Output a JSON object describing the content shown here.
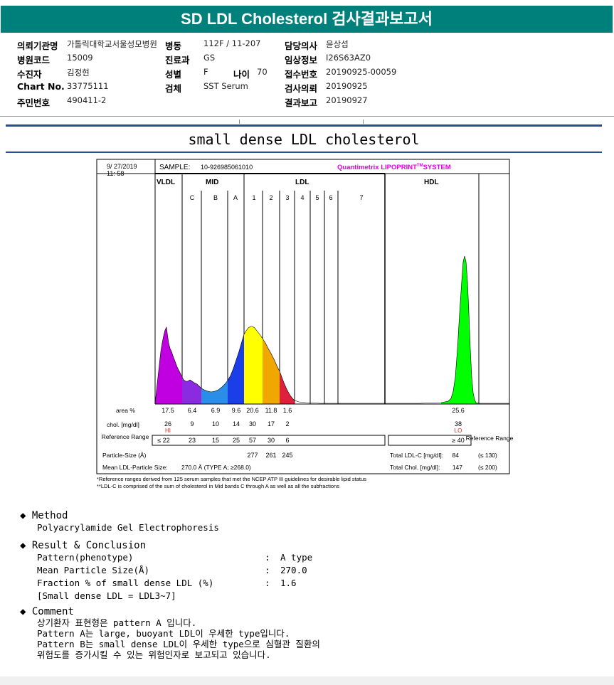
{
  "report_title": "SD LDL Cholesterol 검사결과보고서",
  "info": {
    "r1": {
      "l1": "의뢰기관명",
      "v1": "가톨릭대학교서울성모병원",
      "l2": "병동",
      "v2": "112F / 11-207",
      "l3": "담당의사",
      "v3": "윤상섭"
    },
    "r2": {
      "l1": "병원코드",
      "v1": "15009",
      "l2": "진료과",
      "v2": "GS",
      "l3": "임상정보",
      "v3": "I26S63AZ0"
    },
    "r3": {
      "l1": "수진자",
      "v1": "김정현",
      "l2": "성별",
      "v2": "F",
      "l2b": "나이",
      "v2b": "70",
      "l3": "접수번호",
      "v3": "20190925-00059"
    },
    "r4": {
      "l1": "Chart No.",
      "v1": "33775111",
      "l2": "검체",
      "v2": "SST Serum",
      "l3": "검사의뢰",
      "v3": "20190925"
    },
    "r5": {
      "l1": "주민번호",
      "v1": "490411-2",
      "l3": "결과보고",
      "v3": "20190927"
    }
  },
  "section_title": "small dense LDL cholesterol",
  "chart_data": {
    "type": "area",
    "date": "9/ 27/2019",
    "time": "11: 58",
    "sample_label": "SAMPLE:",
    "sample_id": "10-926985061010",
    "brand": "Quantimetrix LIPOPRINT",
    "brand_tm": "TM",
    "brand_system": "SYSTEM",
    "groups": [
      "VLDL",
      "MID",
      "LDL",
      "HDL"
    ],
    "bands": [
      "C",
      "B",
      "A",
      "1",
      "2",
      "3",
      "4",
      "5",
      "6",
      "7"
    ],
    "row_labels": {
      "area": "area %",
      "chol": "chol. [mg/dl]",
      "ref": "Reference Range",
      "ref_right": "Reference Range",
      "size": "Particle-Size (Å)",
      "mean": "Mean LDL-Particle Size:"
    },
    "area_pct": [
      "17.5",
      "6.4",
      "6.9",
      "9.6",
      "20.6",
      "11.8",
      "1.6",
      "25.6"
    ],
    "chol": [
      "26",
      "9",
      "10",
      "14",
      "30",
      "17",
      "2",
      "38"
    ],
    "flags": {
      "vldl": "HI",
      "hdl": "LO"
    },
    "ref_range": [
      "≤ 22",
      "23",
      "15",
      "25",
      "57",
      "30",
      "6",
      "≥ 40"
    ],
    "particle_size": [
      "277",
      "261",
      "245"
    ],
    "mean_particle_size": "270.0 Å  (TYPE A; ≥268.0)",
    "total_ldl": {
      "label": "Total LDL-C [mg/dl]:",
      "value": "84",
      "ref": "(≤ 130)"
    },
    "total_chol": {
      "label": "Total Chol. [mg/dl]:",
      "value": "147",
      "ref": "(≤ 200)"
    },
    "segment_colors": [
      "#c000e0",
      "#8a2be2",
      "#2a8de8",
      "#1a3ee8",
      "#ffff00",
      "#f0a800",
      "#e0203a",
      "#00ff00"
    ],
    "footnotes": [
      "*Reference ranges derived from 125 serum samples that met the NCEP ATP III guidelines for desirable lipid status",
      "**LDL-C is comprised of the sum of cholesterol in Mid bands C through A as well as all the subfractions"
    ]
  },
  "method": {
    "title": "Method",
    "text": "Polyacrylamide Gel Electrophoresis"
  },
  "result": {
    "title": "Result & Conclusion",
    "rows": [
      {
        "label": "Pattern(phenotype)",
        "value": "A type"
      },
      {
        "label": "Mean Particle Size(Å)",
        "value": "270.0"
      },
      {
        "label": "Fraction % of small dense LDL (%)",
        "value": "1.6"
      }
    ],
    "note": "[Small dense LDL = LDL3~7]"
  },
  "comment": {
    "title": "Comment",
    "lines": [
      "상기환자 표현형은 pattern A 입니다.",
      "Pattern A는 large, buoyant LDL이 우세한 type입니다.",
      "Pattern B는 small dense LDL이 우세한 type으로 심혈관 질환의",
      "위험도를 증가시킬 수 있는 위험인자로 보고되고 있습니다."
    ]
  }
}
